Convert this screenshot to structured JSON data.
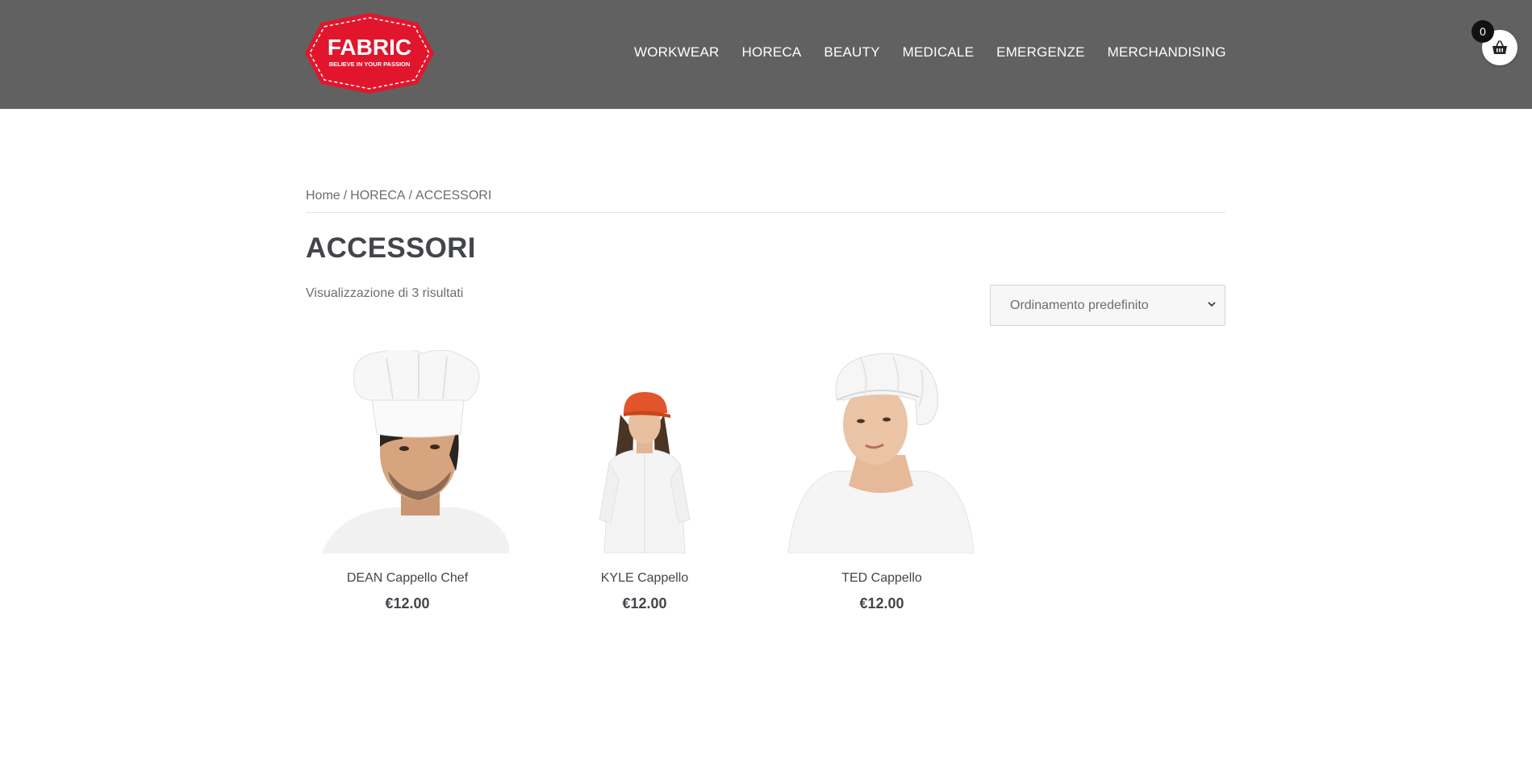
{
  "brand": {
    "name": "FABRIC",
    "tagline": "BELIEVE IN YOUR PASSION",
    "color": "#e1162d"
  },
  "nav": {
    "items": [
      "WORKWEAR",
      "HORECA",
      "BEAUTY",
      "MEDICALE",
      "EMERGENZE",
      "MERCHANDISING"
    ]
  },
  "cart": {
    "count": "0",
    "icon": "basket-icon"
  },
  "breadcrumb": {
    "home": "Home",
    "separator": "/",
    "category": "HORECA",
    "current": "ACCESSORI"
  },
  "page": {
    "title": "ACCESSORI",
    "result_count": "Visualizzazione di 3 risultati"
  },
  "sort": {
    "selected": "Ordinamento predefinito"
  },
  "products": [
    {
      "name": "DEAN Cappello Chef",
      "price": "€12.00"
    },
    {
      "name": "KYLE Cappello",
      "price": "€12.00"
    },
    {
      "name": "TED Cappello",
      "price": "€12.00"
    }
  ],
  "colors": {
    "header_bg": "#616161",
    "text": "#43454b",
    "muted": "#6d6d6d"
  }
}
